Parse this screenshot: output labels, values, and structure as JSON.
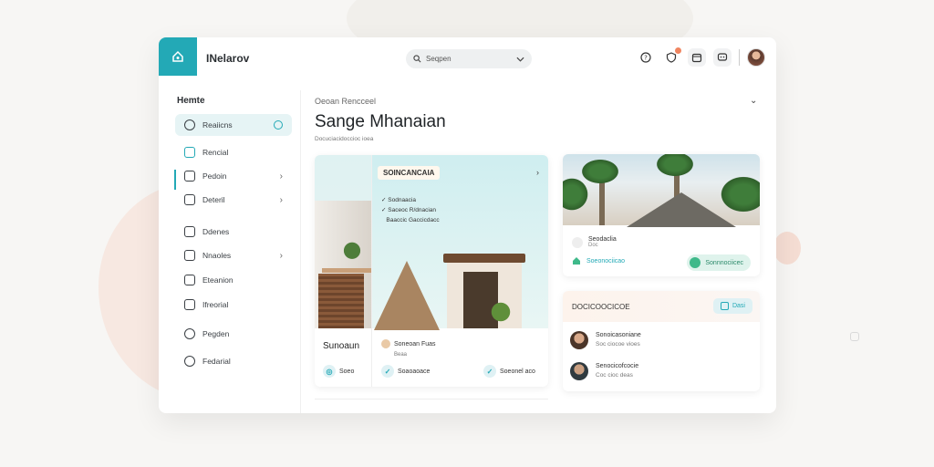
{
  "header": {
    "brand": "INelarov",
    "search": {
      "placeholder": "Seqpen"
    }
  },
  "sidebar": {
    "title": "Hemte",
    "items": [
      {
        "label": "Reaiicns",
        "icon": "chat-icon",
        "active": true
      },
      {
        "label": "Rencial",
        "icon": "cube-icon"
      },
      {
        "label": "Pedoin",
        "icon": "document-icon"
      },
      {
        "label": "Deteril",
        "icon": "checkbox-icon"
      },
      {
        "label": "Ddenes",
        "icon": "folder-icon"
      },
      {
        "label": "Nnaoles",
        "icon": "list-icon"
      },
      {
        "label": "Eteanion",
        "icon": "mail-icon"
      },
      {
        "label": "Ifreorial",
        "icon": "bag-icon"
      },
      {
        "label": "Pegden",
        "icon": "chat-bubble-icon"
      },
      {
        "label": "Fedarial",
        "icon": "globe-icon"
      }
    ]
  },
  "main": {
    "subtitle": "Oeoan Rencceel",
    "title": "Sange Mhanaian",
    "meta": "Docuciacidoccioc ioea"
  },
  "cardA": {
    "tag": "SOINCANCAIA",
    "checks": [
      "Sodnaacia",
      "Saceoc R/dnacian",
      "Baaccic Gaccicdacc"
    ],
    "title": "Sunoaun",
    "info_name": "Soneoan Fuas",
    "info_sub": "Beaa",
    "pills": [
      "Soeo",
      "Soaoaoace",
      "Soeonel aco"
    ]
  },
  "cardB": {
    "name": "Seodaclia",
    "sub": "Doc",
    "home_label": "Soeonociicao",
    "pill_label": "Sonnnociicec"
  },
  "cardC": {
    "title": "DOCICOOCICOE",
    "button_label": "Dasi",
    "rows": [
      {
        "name": "Sonoicasoniane",
        "sub": "Soc ciocoe vioes"
      },
      {
        "name": "Senocicofcocie",
        "sub": "Coc cioc deas"
      }
    ]
  },
  "colors": {
    "accent": "#23a9b6",
    "accent_light": "#e6f4f5",
    "badge": "#f08560"
  }
}
